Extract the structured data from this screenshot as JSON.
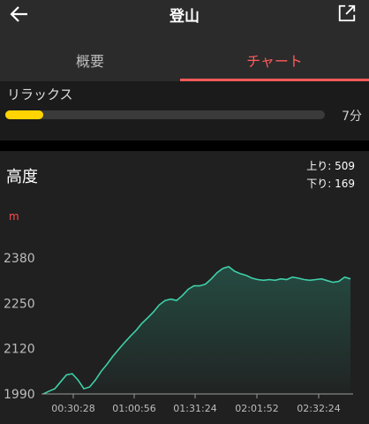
{
  "header": {
    "title": "登山",
    "back_icon": "arrow-left-icon",
    "share_icon": "external-link-icon"
  },
  "tabs": [
    {
      "label": "概要",
      "active": false
    },
    {
      "label": "チャート",
      "active": true
    }
  ],
  "colors": {
    "accent": "#ff5a5a",
    "progress": "#ffd400",
    "line": "#3fd0a8"
  },
  "relax": {
    "label": "リラックス",
    "value": "7分",
    "progress": 0.12
  },
  "altitude": {
    "title": "高度",
    "up": "上り: 509",
    "down": "下り: 169",
    "unit": "m"
  },
  "chart_data": {
    "type": "area",
    "y_ticks": [
      1990,
      2120,
      2250,
      2380
    ],
    "x_ticks": [
      "00:30:28",
      "01:00:56",
      "01:31:24",
      "02:01:52",
      "02:32:24"
    ],
    "ylim": [
      1990,
      2380
    ],
    "xlabel": "",
    "ylabel": "m",
    "grid": false,
    "series": [
      {
        "values": [
          1990,
          1998,
          2005,
          2025,
          2045,
          2048,
          2030,
          2005,
          2010,
          2030,
          2055,
          2075,
          2098,
          2118,
          2137,
          2155,
          2172,
          2192,
          2208,
          2225,
          2245,
          2258,
          2262,
          2258,
          2272,
          2290,
          2300,
          2300,
          2305,
          2320,
          2338,
          2350,
          2355,
          2342,
          2335,
          2330,
          2322,
          2318,
          2316,
          2318,
          2316,
          2320,
          2318,
          2325,
          2322,
          2318,
          2316,
          2318,
          2320,
          2315,
          2310,
          2313,
          2325,
          2320
        ]
      }
    ]
  }
}
